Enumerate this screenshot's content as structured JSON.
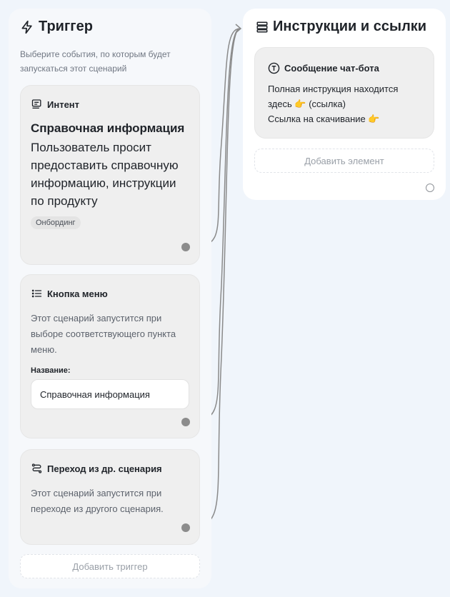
{
  "trigger_panel": {
    "title": "Триггер",
    "description": "Выберите события, по которым будет запускаться этот сценарий",
    "add_label": "Добавить триггер",
    "intent": {
      "header": "Интент",
      "title": "Справочная информация",
      "text": "Пользователь просит предоставить справочную информацию, инструкции по продукту",
      "tag": "Онбординг"
    },
    "menu_button": {
      "header": "Кнопка меню",
      "text": "Этот сценарий запустится при выборе соответствующего пункта меню.",
      "field_label": "Название:",
      "field_value": "Справочная информация"
    },
    "transition": {
      "header": "Переход из др. сценария",
      "text": "Этот сценарий запустится при переходе из другого сценария."
    }
  },
  "instructions_panel": {
    "title": "Инструкции и ссылки",
    "add_label": "Добавить элемент",
    "message": {
      "header": "Сообщение чат-бота",
      "line1": "Полная инструкция находится",
      "line2_prefix": "здесь",
      "line2_suffix": "(ссылка)",
      "line3": "Ссылка на скачивание",
      "emoji": "👉"
    }
  },
  "colors": {
    "background": "#f0f5fb",
    "card": "#efefef",
    "wire": "#8a8a8a"
  }
}
